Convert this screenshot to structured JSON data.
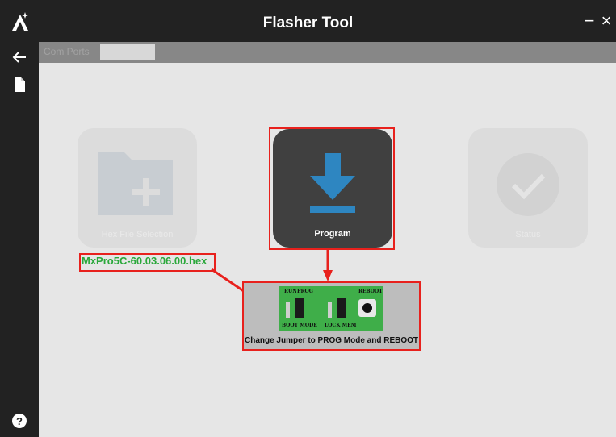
{
  "app": {
    "title": "Flasher Tool"
  },
  "window": {
    "minimize_label": "−",
    "close_label": "×"
  },
  "com": {
    "label": "Com Ports",
    "value": ""
  },
  "tiles": {
    "hex": {
      "label": "Hex File Selection",
      "icon": "folder-plus-icon"
    },
    "program": {
      "label": "Program",
      "icon": "download-icon"
    },
    "status": {
      "label": "Status",
      "icon": "check-circle-icon"
    }
  },
  "file": {
    "name": "MxPro5C-60.03.06.00.hex"
  },
  "board": {
    "run_label": "RUN",
    "prog_label": "PROG",
    "reboot_label": "REBOOT",
    "boot_mode_label": "BOOT MODE",
    "lock_mem_label": "LOCK MEM"
  },
  "instruction": "Change Jumper to PROG Mode and REBOOT",
  "colors": {
    "accent": "#e8211d",
    "program_blue": "#2e86c1",
    "filename_green": "#2ba83b"
  }
}
